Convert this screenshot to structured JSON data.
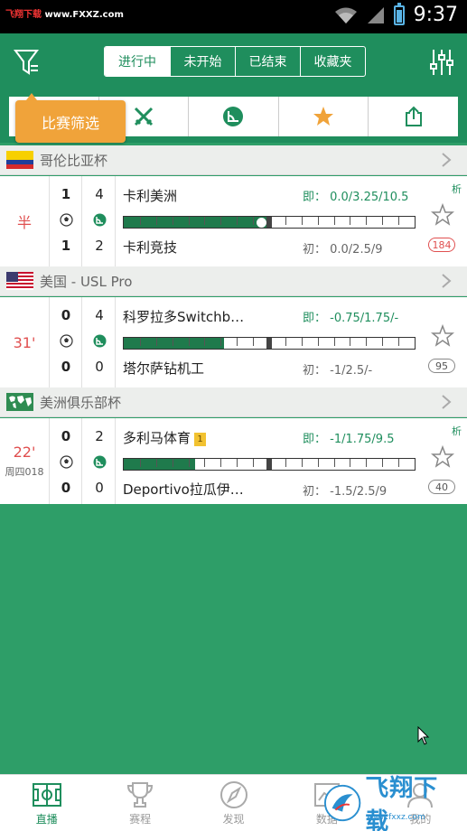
{
  "status_bar": {
    "watermark_prefix": "飞翔下载",
    "watermark_site": "www.FXXZ.com",
    "time": "9:37"
  },
  "tabs": [
    {
      "label": "进行中",
      "active": true
    },
    {
      "label": "未开始",
      "active": false
    },
    {
      "label": "已结束",
      "active": false
    },
    {
      "label": "收藏夹",
      "active": false
    }
  ],
  "icon_row": [
    "trophy-icon",
    "swords-icon",
    "handicap-icon",
    "star-icon",
    "share-icon"
  ],
  "tooltip": "比赛筛选",
  "leagues": [
    {
      "name": "哥伦比亚杯",
      "match": {
        "state": "半",
        "sub": "",
        "home_goals": "1",
        "away_goals": "1",
        "home_corners": "4",
        "away_corners": "2",
        "home_team": "卡利美洲",
        "away_team": "卡利竞技",
        "live_odds": "即： 0.0/3.25/10.5",
        "init_odds": "初： 0.0/2.5/9",
        "count": "184",
        "analysis": "析",
        "progress": 0.5
      }
    },
    {
      "name": "美国 - USL Pro",
      "match": {
        "state": "31'",
        "sub": "",
        "home_goals": "0",
        "away_goals": "0",
        "home_corners": "4",
        "away_corners": "0",
        "home_team": "科罗拉多Switchb…",
        "away_team": "塔尔萨钻机工",
        "live_odds": "即： -0.75/1.75/-",
        "init_odds": "初： -1/2.5/-",
        "count": "95",
        "analysis": "",
        "progress": 0.344
      }
    },
    {
      "name": "美洲俱乐部杯",
      "match": {
        "state": "22'",
        "sub": "周四018",
        "home_goals": "0",
        "away_goals": "0",
        "home_corners": "2",
        "away_corners": "0",
        "home_team": "多利马体育",
        "home_card": "1",
        "away_team": "Deportivo拉瓜伊…",
        "live_odds": "即： -1/1.75/9.5",
        "init_odds": "初： -1.5/2.5/9",
        "count": "40",
        "analysis": "析",
        "progress": 0.244
      }
    }
  ],
  "bottom_nav": [
    {
      "label": "直播",
      "icon": "pitch-icon",
      "active": true
    },
    {
      "label": "赛程",
      "icon": "trophy-icon",
      "active": false
    },
    {
      "label": "发现",
      "icon": "compass-icon",
      "active": false
    },
    {
      "label": "数据",
      "icon": "data-icon",
      "active": false
    },
    {
      "label": "我的",
      "icon": "user-icon",
      "active": false
    }
  ],
  "brand": {
    "name": "飞翔下载",
    "site": "www.fxxz.com"
  },
  "colors": {
    "primary": "#1f8e5d",
    "accent": "#f0a33a",
    "live_red": "#e05050"
  }
}
